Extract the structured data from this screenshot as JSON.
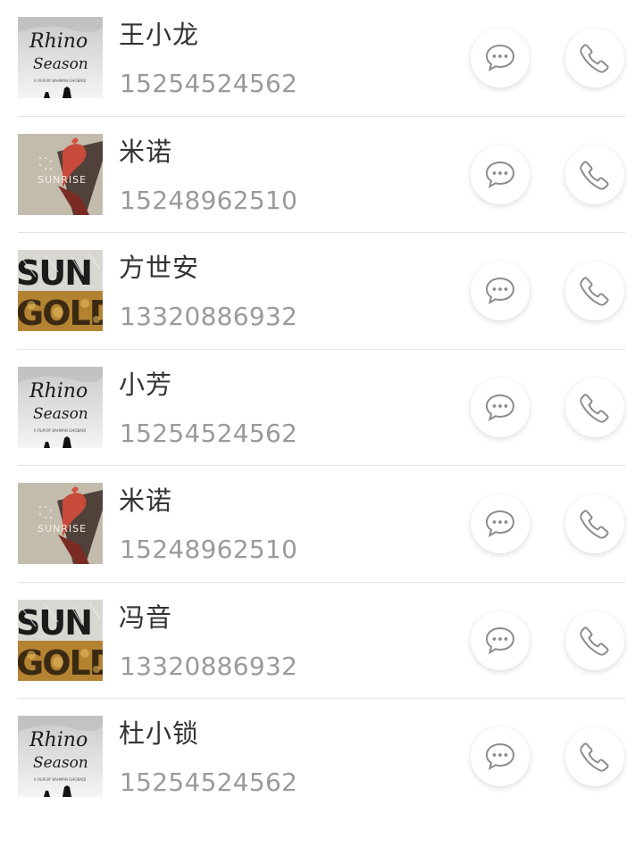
{
  "contacts": [
    {
      "name": "王小龙",
      "phone": "15254524562",
      "poster": "rhino"
    },
    {
      "name": "米诺",
      "phone": "15248962510",
      "poster": "sunrise"
    },
    {
      "name": "方世安",
      "phone": "13320886932",
      "poster": "gold"
    },
    {
      "name": "小芳",
      "phone": "15254524562",
      "poster": "rhino"
    },
    {
      "name": "米诺",
      "phone": "15248962510",
      "poster": "sunrise"
    },
    {
      "name": "冯音",
      "phone": "13320886932",
      "poster": "gold"
    },
    {
      "name": "杜小锁",
      "phone": "15254524562",
      "poster": "rhino"
    }
  ],
  "posters": {
    "rhino": {
      "line1": "Rhino",
      "line2": "Season",
      "caption": "A FILM BY BAHMAN GHOBADI"
    },
    "sunrise": {
      "line1": "SUNRISE"
    },
    "gold": {
      "line1": "SUN",
      "line2": "GOLD"
    }
  },
  "icons": {
    "message": "chat-bubble-icon",
    "call": "phone-icon"
  },
  "colors": {
    "name": "#333333",
    "phone": "#9a9a9a",
    "divider": "#e3e3e3",
    "icon": "#8c8c8c"
  }
}
